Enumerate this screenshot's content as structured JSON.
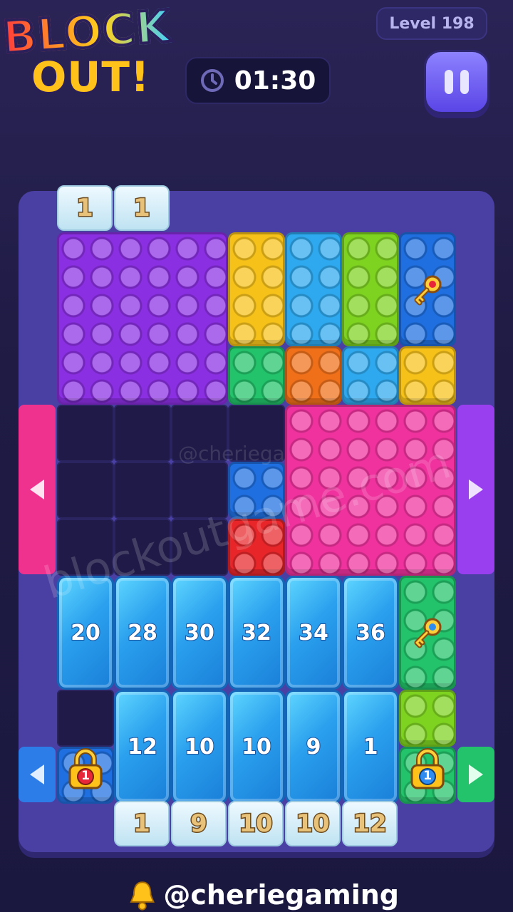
{
  "header": {
    "logo_line1": "BLOCK",
    "logo_line2": "OUT!",
    "level_label": "Level 198",
    "timer": "01:30",
    "timer_icon": "clock-icon",
    "pause_icon": "pause-icon"
  },
  "board": {
    "top_tiles": [
      "1",
      "1"
    ],
    "gem_row1": [
      "20",
      "28",
      "30",
      "32",
      "34",
      "36"
    ],
    "gem_row2": [
      "12",
      "10",
      "10",
      "9",
      "1"
    ],
    "bottom_tiles": [
      "1",
      "9",
      "10",
      "10",
      "12"
    ],
    "lock_left": "1",
    "lock_right": "1",
    "colors": {
      "purple": "#8b2fe3",
      "yellow": "#f6c21a",
      "cyan": "#2ea8ee",
      "lime": "#7ed321",
      "blue": "#1f6fe0",
      "green": "#22c36a",
      "orange": "#f0701a",
      "pink": "#f0329e",
      "red": "#e8262a",
      "gate_pink": "#f0328f",
      "gate_purple": "#9a3ff0",
      "gate_blue": "#2c7de8",
      "gate_green": "#22c36a"
    }
  },
  "watermark": {
    "main": "blockoutgame.com",
    "small": "@cheriega"
  },
  "footer": {
    "handle": "@cheriegaming",
    "bell_icon": "bell-icon"
  }
}
